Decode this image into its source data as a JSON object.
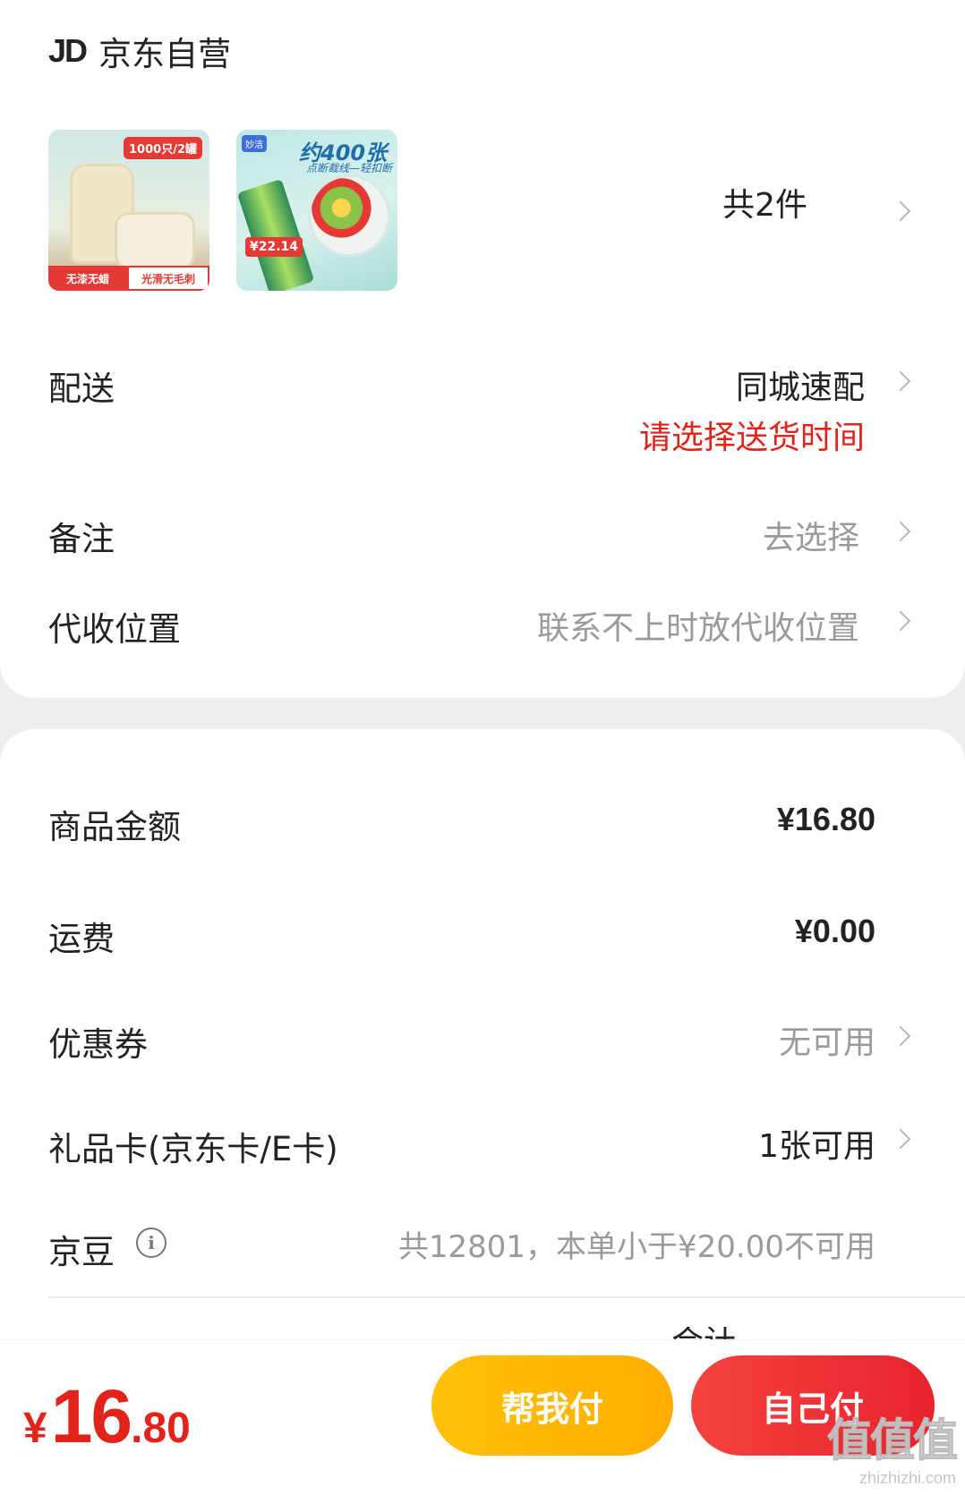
{
  "shop": {
    "logo": "JD",
    "name": "京东自营"
  },
  "products": {
    "count_label": "共2件",
    "items": [
      {
        "badge": "1000只/2罐",
        "bottom_left": "无漆无蜡",
        "bottom_right": "光滑无毛刺"
      },
      {
        "title": "约400张",
        "subtitle": "点断裁线—轻扣断",
        "price": "¥22.14",
        "brand": "妙洁"
      }
    ]
  },
  "delivery": {
    "label": "配送",
    "value": "同城速配",
    "hint": "请选择送货时间"
  },
  "remark": {
    "label": "备注",
    "value": "去选择"
  },
  "pickup": {
    "label": "代收位置",
    "value": "联系不上时放代收位置"
  },
  "summary": {
    "goods": {
      "label": "商品金额",
      "value": "¥16.80"
    },
    "shipping": {
      "label": "运费",
      "value": "¥0.00"
    },
    "coupon": {
      "label": "优惠券",
      "value": "无可用"
    },
    "giftcard": {
      "label": "礼品卡(京东卡/E卡)",
      "value": "1张可用"
    },
    "beans": {
      "label": "京豆",
      "value": "共12801，本单小于¥20.00不可用"
    },
    "total_peek": "合计"
  },
  "footer": {
    "currency": "¥",
    "amount_int": "16",
    "amount_dec": ".80",
    "help_pay": "帮我付",
    "self_pay": "自己付"
  },
  "watermark": {
    "mark": "值值值",
    "site": "zhizhizhi.com"
  }
}
